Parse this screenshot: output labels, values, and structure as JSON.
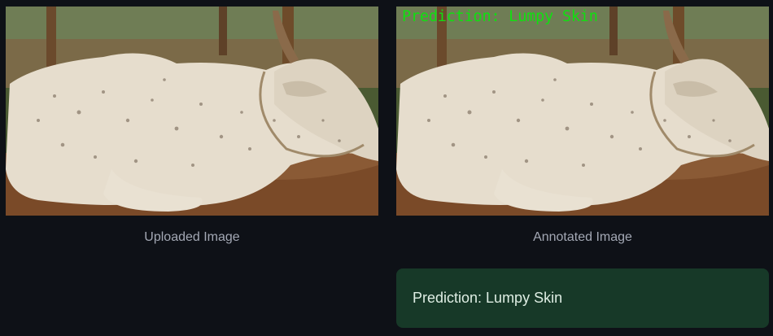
{
  "columns": [
    {
      "caption": "Uploaded Image"
    },
    {
      "caption": "Annotated Image",
      "overlay_text": "Prediction: Lumpy Skin"
    }
  ],
  "result": {
    "message": "Prediction: Lumpy Skin",
    "background_color": "#173928"
  },
  "colors": {
    "page_background": "#0e1117",
    "caption_text": "#a3a8b4",
    "overlay_text": "#10e010"
  }
}
